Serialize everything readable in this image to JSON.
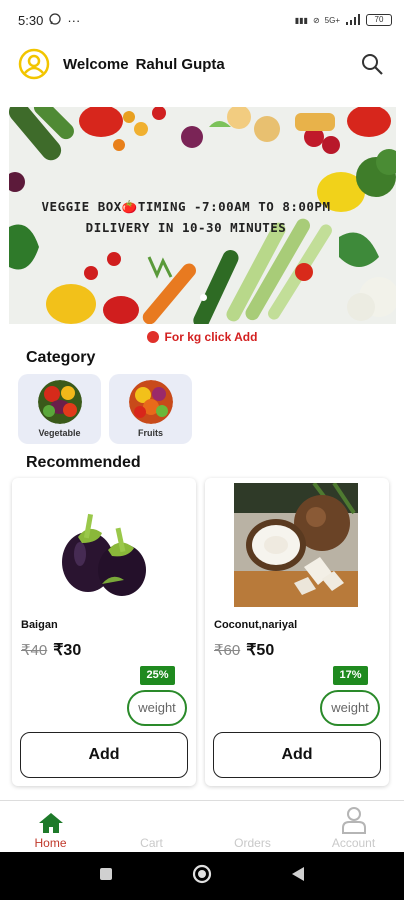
{
  "status_bar": {
    "time": "5:30",
    "dots": "···",
    "network": "5G+",
    "battery": "70"
  },
  "header": {
    "welcome": "Welcome",
    "user_name": "Rahul Gupta"
  },
  "banner": {
    "line1": "VEGGIE BOX🍅TIMING -7:00AM TO 8:00PM",
    "line2": "DILIVERY IN 10-30 MINUTES"
  },
  "notice": "For kg click Add",
  "category": {
    "title": "Category",
    "items": [
      {
        "label": "Vegetable"
      },
      {
        "label": "Fruits"
      }
    ]
  },
  "recommended": {
    "title": "Recommended",
    "products": [
      {
        "name": "Baigan",
        "mrp": "₹40",
        "price": "₹30",
        "discount": "25%",
        "weight_label": "weight",
        "add_label": "Add"
      },
      {
        "name": "Coconut,nariyal",
        "mrp": "₹60",
        "price": "₹50",
        "discount": "17%",
        "weight_label": "weight",
        "add_label": "Add"
      }
    ]
  },
  "bottom_nav": [
    {
      "label": "Home",
      "icon": "home-icon",
      "active": true
    },
    {
      "label": "Cart",
      "icon": "cart-icon",
      "active": false
    },
    {
      "label": "Orders",
      "icon": "orders-icon",
      "active": false
    },
    {
      "label": "Account",
      "icon": "account-icon",
      "active": false
    }
  ],
  "colors": {
    "accent_green": "#1f8a1f",
    "active_red": "#c0392b",
    "notice_red": "#d32020",
    "avatar_yellow": "#f2c500"
  }
}
